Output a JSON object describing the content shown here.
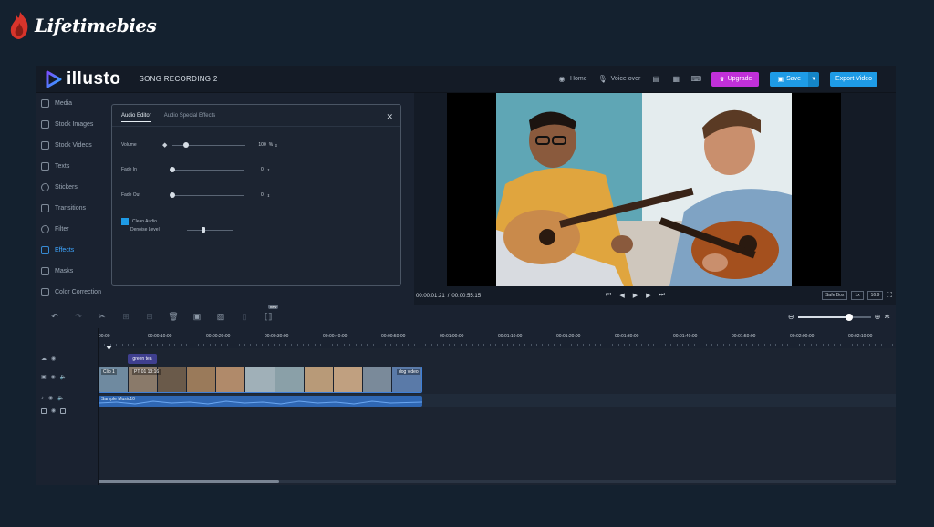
{
  "watermark": {
    "text": "Lifetimebies"
  },
  "topbar": {
    "logo_text": "illusto",
    "project_title": "SONG RECORDING 2",
    "home_label": "Home",
    "voiceover_label": "Voice over",
    "upgrade_label": "Upgrade",
    "save_label": "Save",
    "export_label": "Export Video"
  },
  "sidebar": {
    "items": [
      {
        "label": "Media",
        "icon": "layers-icon"
      },
      {
        "label": "Stock Images",
        "icon": "stack-icon"
      },
      {
        "label": "Stock Videos",
        "icon": "stack-icon"
      },
      {
        "label": "Texts",
        "icon": "text-icon"
      },
      {
        "label": "Stickers",
        "icon": "sticker-icon"
      },
      {
        "label": "Transitions",
        "icon": "transition-icon"
      },
      {
        "label": "Filter",
        "icon": "filter-icon"
      },
      {
        "label": "Effects",
        "icon": "effects-icon",
        "active": true
      },
      {
        "label": "Masks",
        "icon": "mask-icon"
      },
      {
        "label": "Color Correction",
        "icon": "color-icon"
      }
    ]
  },
  "audio_panel": {
    "tabs": [
      "Audio Editor",
      "Audio Special Effects"
    ],
    "active_tab": "Audio Editor",
    "volume": {
      "label": "Volume",
      "value": "100",
      "unit": "%"
    },
    "fade_in": {
      "label": "Fade In",
      "value": "0"
    },
    "fade_out": {
      "label": "Fade Out",
      "value": "0"
    },
    "clean_audio": {
      "label": "Clean Audio",
      "checked": true,
      "sub_label": "Denoise Level"
    }
  },
  "preview": {
    "current_time": "00:00:01:21",
    "total_time": "00:00:55:15",
    "safe_box_label": "Safe Box",
    "speed_label": "1x",
    "ratio_label": "16:9"
  },
  "toolbar": {
    "badge": "new"
  },
  "timeline": {
    "ticks": [
      "00:00",
      "00:00:10:00",
      "00:00:20:00",
      "00:00:30:00",
      "00:00:40:00",
      "00:00:50:00",
      "00:01:00:00",
      "00:01:10:00",
      "00:01:20:00",
      "00:01:30:00",
      "00:01:40:00",
      "00:01:50:00",
      "00:02:00:00",
      "00:02:10:00"
    ],
    "text_clip_label": "green tea",
    "video_clips": [
      {
        "label": "Clip 1"
      },
      {
        "label": "PT 01 13:16"
      },
      {
        "label": "dog video"
      }
    ],
    "audio_clip_label": "Sample Music10"
  },
  "colors": {
    "accent": "#1e9be6",
    "upgrade": "#c130d9",
    "background": "#14212f"
  }
}
